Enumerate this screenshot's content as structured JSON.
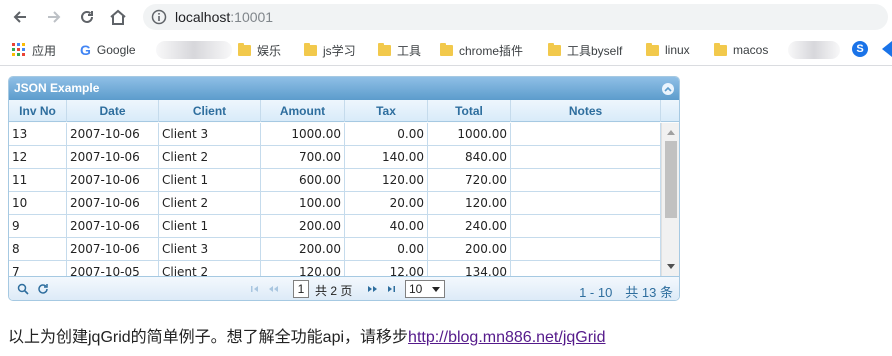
{
  "browser": {
    "url_host": "localhost",
    "url_port": ":10001",
    "bookmarks": {
      "apps": "应用",
      "google": "Google",
      "b1": "娱乐",
      "b2": "js学习",
      "b3": "工具",
      "b4": "chrome插件",
      "b5": "工具byself",
      "b6": "linux",
      "b7": "macos"
    },
    "ext_s": "S"
  },
  "grid": {
    "caption": "JSON Example",
    "columns": [
      "Inv No",
      "Date",
      "Client",
      "Amount",
      "Tax",
      "Total",
      "Notes"
    ],
    "rows": [
      [
        "13",
        "2007-10-06",
        "Client 3",
        "1000.00",
        "0.00",
        "1000.00",
        ""
      ],
      [
        "12",
        "2007-10-06",
        "Client 2",
        "700.00",
        "140.00",
        "840.00",
        ""
      ],
      [
        "11",
        "2007-10-06",
        "Client 1",
        "600.00",
        "120.00",
        "720.00",
        ""
      ],
      [
        "10",
        "2007-10-06",
        "Client 2",
        "100.00",
        "20.00",
        "120.00",
        ""
      ],
      [
        "9",
        "2007-10-06",
        "Client 1",
        "200.00",
        "40.00",
        "240.00",
        ""
      ],
      [
        "8",
        "2007-10-06",
        "Client 3",
        "200.00",
        "0.00",
        "200.00",
        ""
      ],
      [
        "7",
        "2007-10-05",
        "Client 2",
        "120.00",
        "12.00",
        "134.00",
        ""
      ]
    ],
    "pager": {
      "page": "1",
      "of_pages": "共 2 页",
      "rows_per_page": "10",
      "records": "1 - 10　共 13 条"
    }
  },
  "note": {
    "text": "以上为创建jqGrid的简单例子。想了解全功能api，请移步",
    "link": "http://blog.mn886.net/jqGrid"
  }
}
